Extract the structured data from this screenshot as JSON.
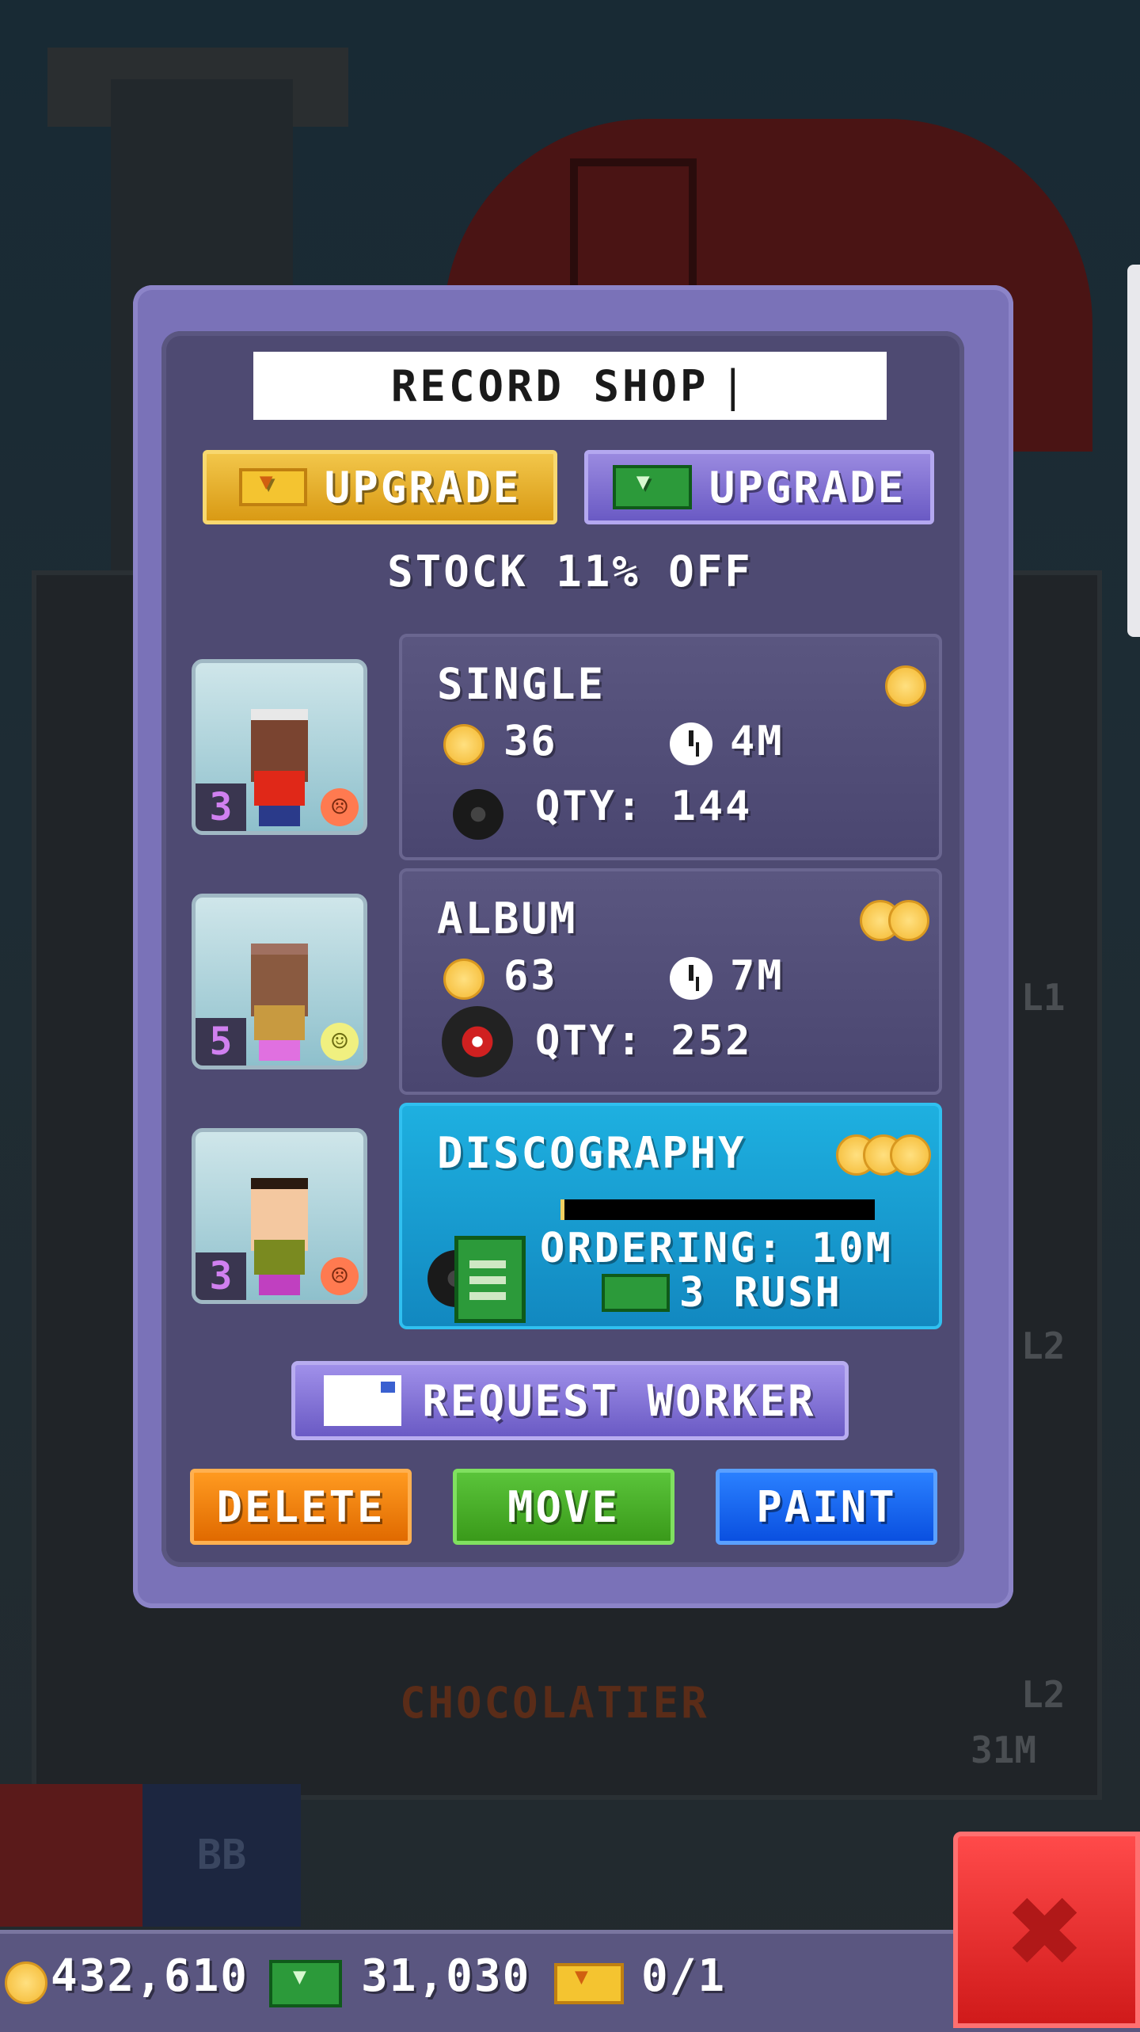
{
  "shop": {
    "title": "RECORD SHOP",
    "upgrade_gold_label": "UPGRADE",
    "upgrade_bux_label": "UPGRADE",
    "stock_discount": "STOCK 11% OFF"
  },
  "products": [
    {
      "name": "SINGLE",
      "cost": "36",
      "time": "4M",
      "qty": "QTY: 144",
      "worker_level": "3",
      "worker_mood": "unhappy",
      "coin_tier": 1
    },
    {
      "name": "ALBUM",
      "cost": "63",
      "time": "7M",
      "qty": "QTY: 252",
      "worker_level": "5",
      "worker_mood": "neutral",
      "coin_tier": 2
    },
    {
      "name": "DISCOGRAPHY",
      "status": "ORDERING: 10M",
      "rush": "3 RUSH",
      "worker_level": "3",
      "worker_mood": "unhappy",
      "coin_tier": 3,
      "progress": 0.0
    }
  ],
  "actions": {
    "request_worker": "REQUEST WORKER",
    "delete": "DELETE",
    "move": "MOVE",
    "paint": "PAINT"
  },
  "background": {
    "floor_label": "CHOCOLATIER",
    "side_labels": [
      "L1",
      "L2",
      "L2",
      "31M",
      "BB"
    ]
  },
  "status_bar": {
    "coins": "432,610",
    "bux": "31,030",
    "tickets": "0/1"
  },
  "icons": {
    "coin": "coin-icon",
    "bux": "bux-icon",
    "ticket": "ticket-icon",
    "clock": "clock-icon",
    "record": "record-icon",
    "close": "close-icon"
  },
  "colors": {
    "modal_bg": "#4e4a72",
    "modal_frame": "#7a72b8",
    "active_product": "#1eb0e0",
    "delete": "#e06a00",
    "move": "#3a9a1a",
    "paint": "#0a50e0",
    "close": "#d01a1a"
  }
}
